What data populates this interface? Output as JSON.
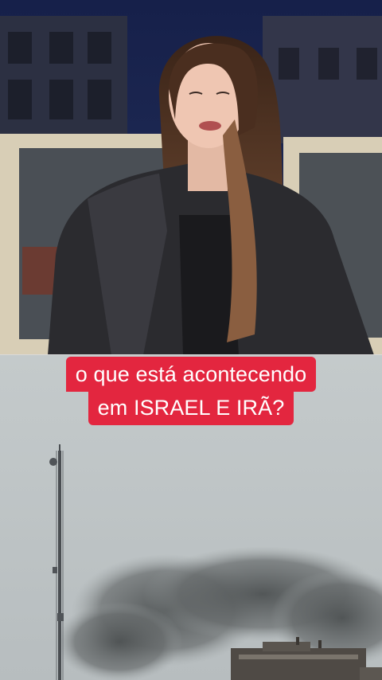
{
  "caption": {
    "line1": "o que está acontecendo",
    "line2": "em ISRAEL E IRÃ?"
  },
  "colors": {
    "caption_bg": "#e3263f",
    "caption_text": "#ffffff",
    "night_sky": "#1b2552",
    "hazy_sky": "#c6cccd",
    "smoke": "#55595a"
  },
  "scene": {
    "top_video": "news-reporter-outdoor-night",
    "bottom_video": "smoke-over-buildings-with-antenna-tower"
  }
}
